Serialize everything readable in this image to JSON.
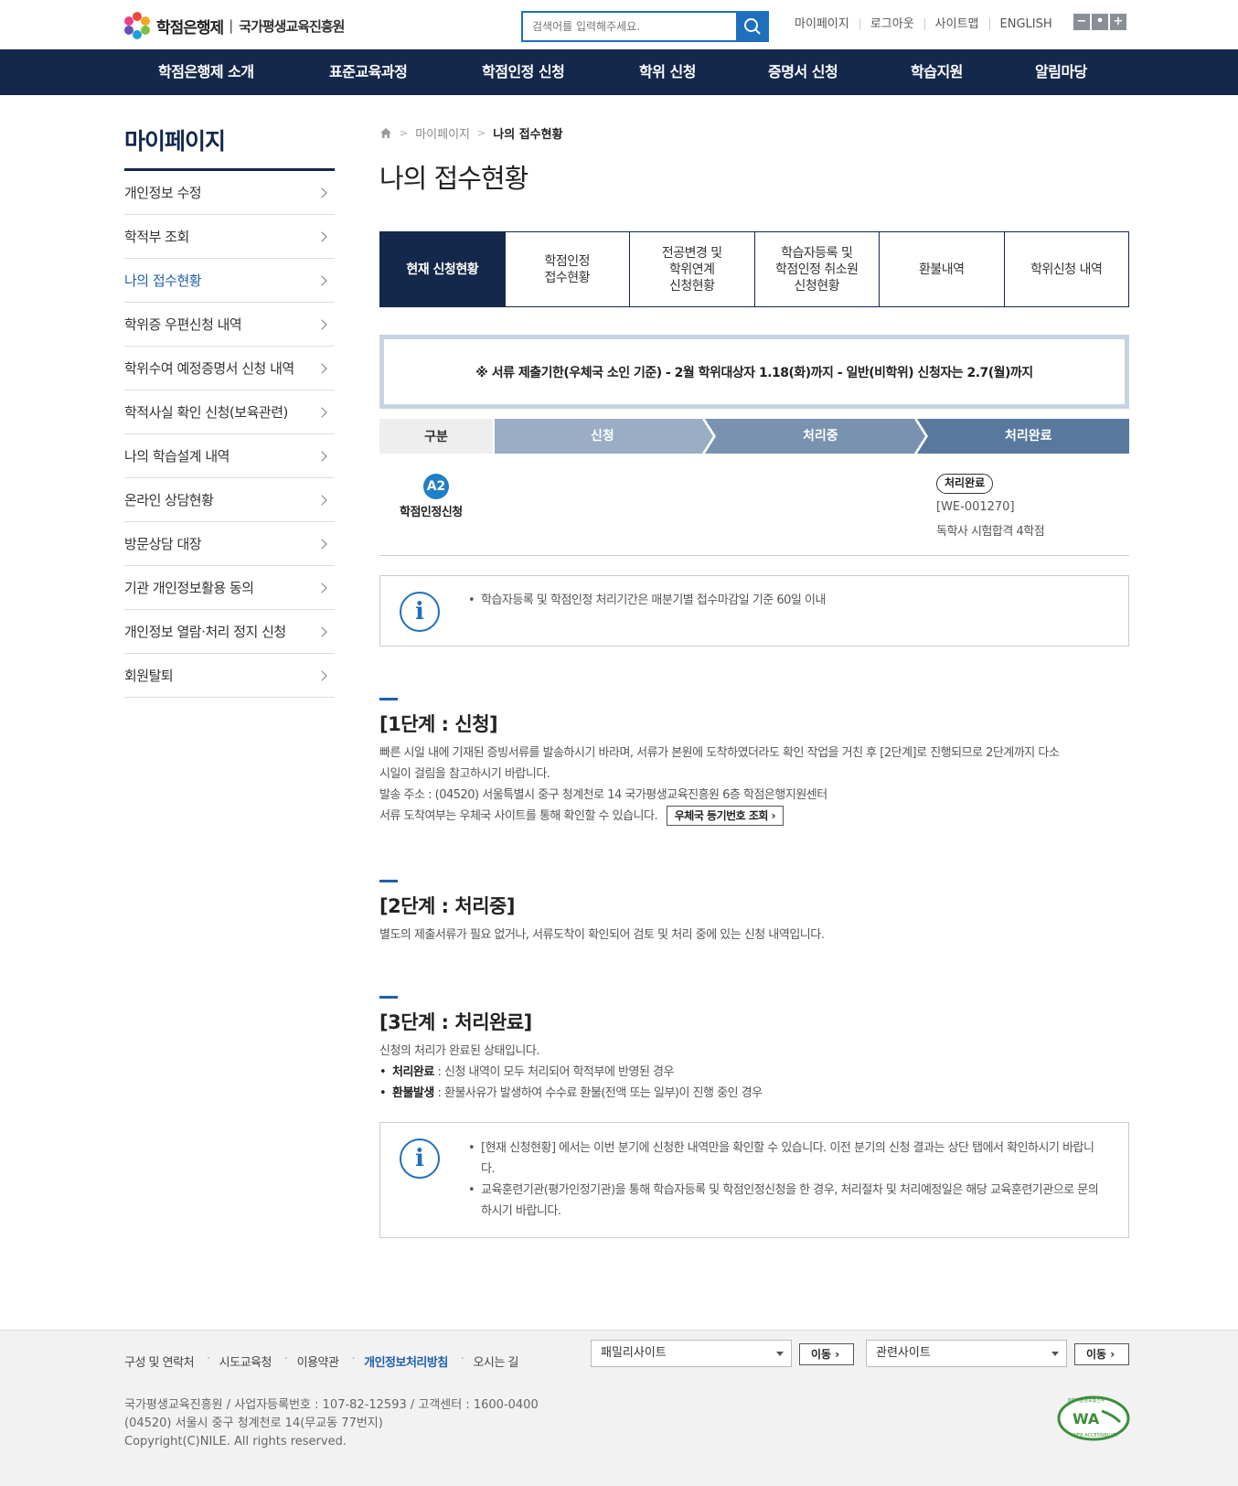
{
  "header": {
    "logo_name": "학점은행제",
    "logo_org": "국가평생교육진흥원",
    "search_placeholder": "검색어를 입력해주세요.",
    "util": [
      "마이페이지",
      "로그아웃",
      "사이트맵",
      "ENGLISH"
    ],
    "zoom": [
      "−",
      "•",
      "+"
    ]
  },
  "gnb": [
    "학점은행제 소개",
    "표준교육과정",
    "학점인정 신청",
    "학위 신청",
    "증명서 신청",
    "학습지원",
    "알림마당"
  ],
  "lnb": {
    "title": "마이페이지",
    "items": [
      {
        "label": "개인정보 수정"
      },
      {
        "label": "학적부 조회"
      },
      {
        "label": "나의 접수현황"
      },
      {
        "label": "학위증 우편신청 내역"
      },
      {
        "label": "학위수여 예정증명서 신청 내역"
      },
      {
        "label": "학적사실 확인 신청(보육관련)"
      },
      {
        "label": "나의 학습설계 내역"
      },
      {
        "label": "온라인 상담현황"
      },
      {
        "label": "방문상담 대장"
      },
      {
        "label": "기관 개인정보활용 동의"
      },
      {
        "label": "개인정보 열람·처리 정지 신청"
      },
      {
        "label": "회원탈퇴"
      }
    ],
    "active_index": 2
  },
  "breadcrumb": [
    "마이페이지",
    "나의 접수현황"
  ],
  "page_title": "나의 접수현황",
  "tabs": [
    "현재 신청현황",
    "학점인정\n접수현황",
    "전공변경 및\n학위연계\n신청현황",
    "학습자등록 및\n학점인정 취소원\n신청현황",
    "환불내역",
    "학위신청 내역"
  ],
  "notice": "※ 서류 제출기한(우체국 소인 기준) - 2월 학위대상자 1.18(화)까지 - 일반(비학위) 신청자는 2.7(월)까지",
  "steps": {
    "gubun": "구분",
    "labels": [
      "신청",
      "처리중",
      "처리완료"
    ]
  },
  "entry": {
    "badge": "A2",
    "label": "학점인정신청",
    "status": "처리완료",
    "code": "[WE-001270]",
    "desc": "독학사 시험합격 4학점"
  },
  "info1": [
    "학습자등록 및 학점인정 처리기간은 매분기별 접수마감일 기준 60일 이내"
  ],
  "info_icon": "i",
  "sec1": {
    "title": "[1단계 : 신청]",
    "line1": "빠른 시일 내에 기재된 증빙서류를 발송하시기 바라며, 서류가 본원에 도착하였더라도 확인 작업을 거친 후 [2단계]로 진행되므로 2단계까지 다소",
    "line2": "시일이 걸림을 참고하시기 바랍니다.",
    "line3": "발송 주소 : (04520) 서울특별시 중구 청계천로 14 국가평생교육진흥원 6층 학점은행지원센터",
    "line4": "서류 도착여부는 우체국 사이트를 통해 확인할 수 있습니다.",
    "button": "우체국 등기번호 조회"
  },
  "sec2": {
    "title": "[2단계 : 처리중]",
    "line1": "별도의 제출서류가 필요 없거나, 서류도착이 확인되어 검토 및 처리 중에 있는 신청 내역입니다."
  },
  "sec3": {
    "title": "[3단계 : 처리완료]",
    "line1": "신청의 처리가 완료된 상태입니다.",
    "b1_key": "처리완료",
    "b1_val": " : 신청 내역이 모두 처리되어 학적부에 반영된 경우",
    "b2_key": "환불발생",
    "b2_val": " : 환불사유가 발생하여 수수료 환불(전액 또는 일부)이 진행 중인 경우"
  },
  "info2": [
    "[현재 신청현황] 에서는 이번 분기에 신청한 내역만을 확인할 수 있습니다. 이전 분기의 신청 결과는 상단 탭에서 확인하시기 바랍니다.",
    "교육훈련기관(평가인정기관)을 통해 학습자등록 및 학점인정신청을 한 경우, 처리절차 및 처리예정일은 해당 교육훈련기관으로 문의하시기 바랍니다."
  ],
  "footer": {
    "links": [
      "구성 및 연락처",
      "시도교육청",
      "이용약관",
      "개인정보처리방침",
      "오시는 길"
    ],
    "family_select": "패밀리사이트",
    "related_select": "관련사이트",
    "go": "이동",
    "info1": "국가평생교육진흥원 / 사업자등록번호 : 107-82-12593 / 고객센터 : 1600-0400",
    "info2": "(04520) 서울시 중구 청계천로 14(무교동 77번지)",
    "info3": "Copyright(C)NILE. All rights reserved.",
    "wa_mark": "WA",
    "wa_top": "과학기술정보통신부",
    "wa_bottom": "WEB ACCESSIBILITY"
  },
  "colors": {
    "navy": "#14284b",
    "blue": "#1f5fae",
    "step1": "#99adc4",
    "step2": "#7892b0",
    "step3": "#58789e"
  }
}
